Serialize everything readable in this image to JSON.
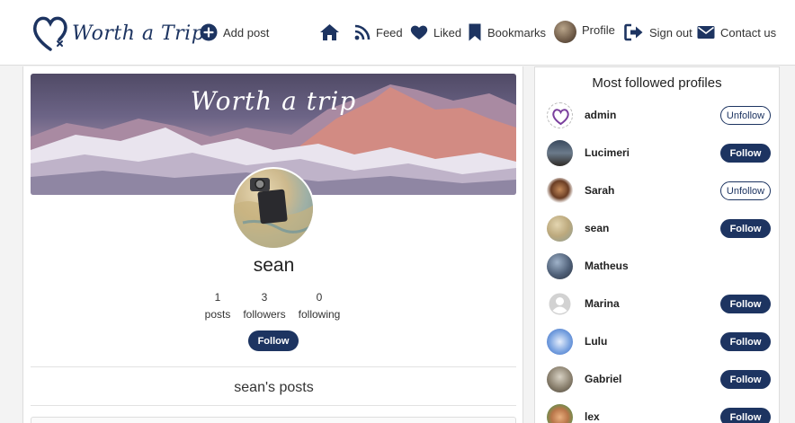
{
  "navbar": {
    "brand": "Worth a Trip",
    "add_post": "Add post",
    "feed": "Feed",
    "liked": "Liked",
    "bookmarks": "Bookmarks",
    "profile": "Profile",
    "sign_out": "Sign out",
    "contact": "Contact us"
  },
  "profile": {
    "banner_title": "Worth a trip",
    "username": "sean",
    "stats": [
      {
        "value": "1",
        "label": "posts"
      },
      {
        "value": "3",
        "label": "followers"
      },
      {
        "value": "0",
        "label": "following"
      }
    ],
    "follow_label": "Follow",
    "posts_title": "sean's posts"
  },
  "sidebar": {
    "title": "Most followed profiles",
    "profiles": [
      {
        "name": "admin",
        "button": "Unfollow",
        "button_style": "unfollow",
        "avatar": "heart-logo"
      },
      {
        "name": "Lucimeri",
        "button": "Follow",
        "button_style": "follow",
        "avatar": "photo"
      },
      {
        "name": "Sarah",
        "button": "Unfollow",
        "button_style": "unfollow",
        "avatar": "photo"
      },
      {
        "name": "sean",
        "button": "Follow",
        "button_style": "follow",
        "avatar": "photo"
      },
      {
        "name": "Matheus",
        "button": "",
        "button_style": "none",
        "avatar": "photo"
      },
      {
        "name": "Marina",
        "button": "Follow",
        "button_style": "follow",
        "avatar": "default-user"
      },
      {
        "name": "Lulu",
        "button": "Follow",
        "button_style": "follow",
        "avatar": "photo"
      },
      {
        "name": "Gabriel",
        "button": "Follow",
        "button_style": "follow",
        "avatar": "photo"
      },
      {
        "name": "lex",
        "button": "Follow",
        "button_style": "follow",
        "avatar": "photo"
      }
    ]
  },
  "colors": {
    "primary": "#1d3461",
    "background": "#f3f3f3"
  }
}
